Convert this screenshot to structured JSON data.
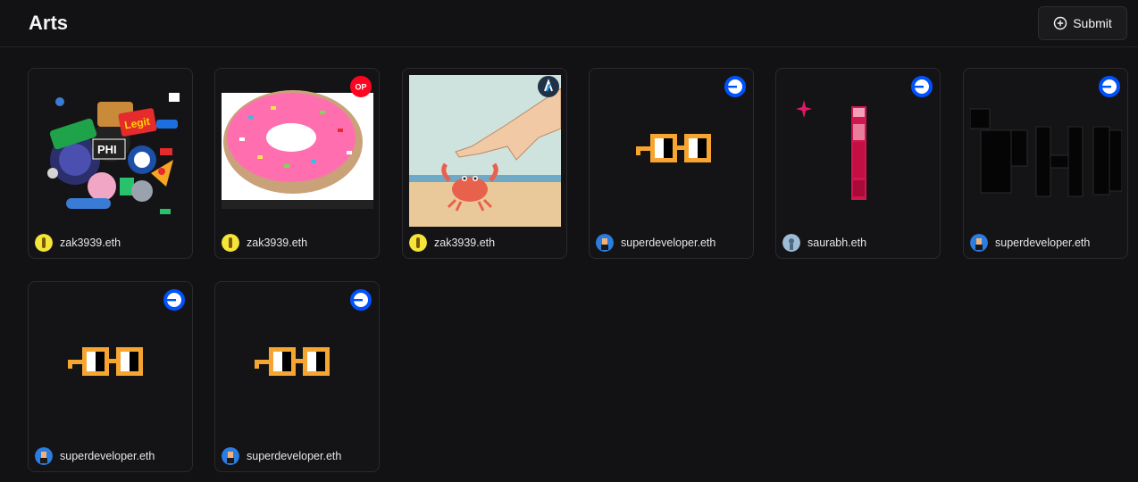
{
  "header": {
    "title": "Arts",
    "submit_label": "Submit"
  },
  "cards": [
    {
      "creator": "zak3939.eth",
      "art": "sticker-collage",
      "chain": "base",
      "avatar": "yellow-avatar"
    },
    {
      "creator": "zak3939.eth",
      "art": "pixel-donut",
      "chain": "optimism",
      "avatar": "yellow-avatar"
    },
    {
      "creator": "zak3939.eth",
      "art": "crab-on-beach",
      "chain": "arbitrum",
      "avatar": "yellow-avatar"
    },
    {
      "creator": "superdeveloper.eth",
      "art": "pixel-glasses",
      "chain": "base",
      "avatar": "blue-avatar"
    },
    {
      "creator": "saurabh.eth",
      "art": "pink-bar",
      "chain": "base",
      "avatar": "sky-avatar"
    },
    {
      "creator": "superdeveloper.eth",
      "art": "dark-phi-logo",
      "chain": "base",
      "avatar": "blue-avatar"
    },
    {
      "creator": "superdeveloper.eth",
      "art": "pixel-glasses",
      "chain": "base",
      "avatar": "blue-avatar"
    },
    {
      "creator": "superdeveloper.eth",
      "art": "pixel-glasses",
      "chain": "base",
      "avatar": "blue-avatar"
    }
  ],
  "colors": {
    "background": "#121214",
    "card_border": "#2a2a2f",
    "base_blue": "#0052ff",
    "optimism_red": "#ff0420",
    "glasses_orange": "#f7a531"
  }
}
